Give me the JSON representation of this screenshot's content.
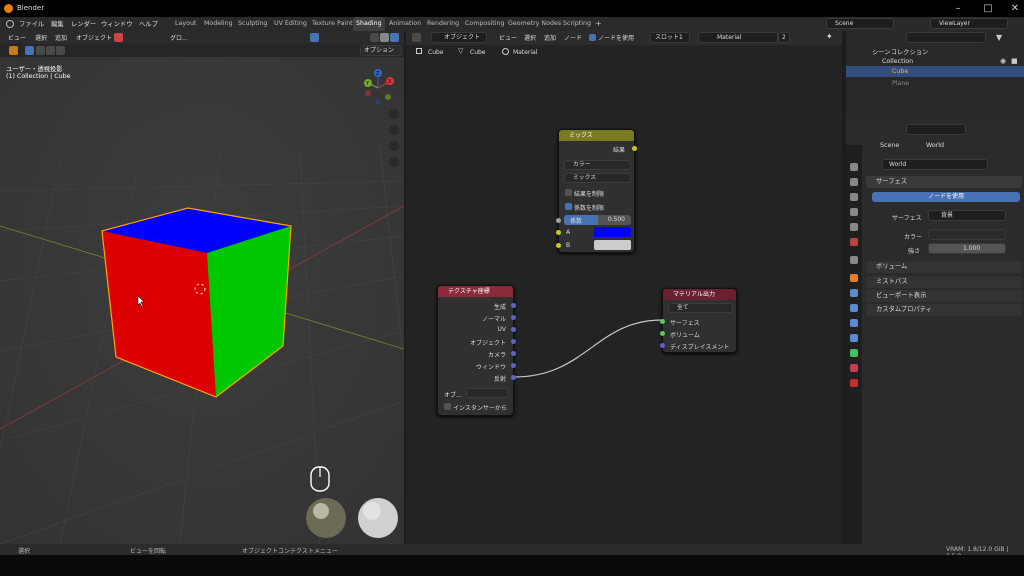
{
  "title": "Blender",
  "menu": [
    "ファイル",
    "編集",
    "レンダー",
    "ウィンドウ",
    "ヘルプ"
  ],
  "workspaces": [
    "Layout",
    "Modeling",
    "Sculpting",
    "UV Editing",
    "Texture Paint",
    "Shading",
    "Animation",
    "Rendering",
    "Compositing",
    "Geometry Nodes",
    "Scripting"
  ],
  "active_workspace": "Shading",
  "scene": "Scene",
  "view_layer": "ViewLayer",
  "viewport": {
    "menu": [
      "ビュー",
      "選択",
      "追加",
      "オブジェクト"
    ],
    "transform": "グロ...",
    "options": "オプション",
    "view_name": "ユーザー・透視投影",
    "collection_info": "(1) Collection | Cube",
    "axes": {
      "x": "X",
      "y": "Y",
      "z": "Z"
    }
  },
  "node_editor": {
    "mode": "オブジェクト",
    "menu": [
      "ビュー",
      "選択",
      "追加",
      "ノード"
    ],
    "use_nodes": "ノードを使用",
    "slot": "スロット1",
    "material": "Material",
    "users": "2",
    "breadcrumb": [
      "Cube",
      "Cube",
      "Material"
    ],
    "mix": {
      "title": "ミックス",
      "out": "結果",
      "type": "カラー",
      "blend": "ミックス",
      "clamp_result": "結果を制限",
      "clamp_factor": "係数を制限",
      "factor_label": "係数",
      "factor_value": "0.500",
      "a": "A",
      "b": "B",
      "a_color": "#0000ff",
      "b_color": "#cccccc"
    },
    "texcoord": {
      "title": "テクスチャ座標",
      "outputs": [
        "生成",
        "ノーマル",
        "UV",
        "オブジェクト",
        "カメラ",
        "ウィンドウ",
        "反射"
      ],
      "object_label": "オブ...",
      "instancer": "インスタンサーから"
    },
    "matout": {
      "title": "マテリアル出力",
      "target": "全て",
      "inputs": [
        "サーフェス",
        "ボリューム",
        "ディスプレイスメント"
      ]
    }
  },
  "outliner": {
    "root": "シーンコレクション",
    "items": [
      "Collection",
      "Cube",
      "Plane"
    ]
  },
  "properties": {
    "breadcrumb": [
      "Scene",
      "World"
    ],
    "world_name": "World",
    "surface_panel": "サーフェス",
    "use_nodes_btn": "ノードを使用",
    "surface_label": "サーフェス",
    "surface_value": "背景",
    "color_label": "カラー",
    "strength_label": "強さ",
    "strength_value": "1.000",
    "panels": [
      "ボリューム",
      "ミストパス",
      "ビューポート表示",
      "カスタムプロパティ"
    ]
  },
  "status": {
    "select": "選択",
    "rotate": "ビューを回転",
    "context": "オブジェクトコンテクストメニュー",
    "vram": "VRAM: 1.8/12.0 GiB | 3.5.0"
  },
  "colors": {
    "cube_top": "#0000ff",
    "cube_front": "#e00000",
    "cube_side": "#00c800",
    "mix_header": "#7a7a1f",
    "input_header": "#8a2a3a",
    "output_header": "#6a2030",
    "accent": "#4772b3"
  }
}
